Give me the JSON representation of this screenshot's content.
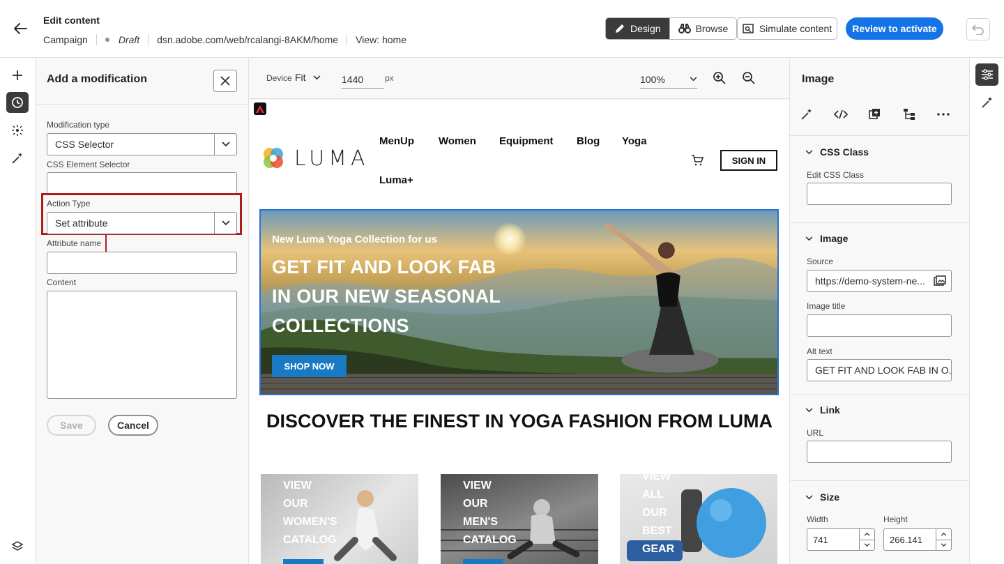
{
  "header": {
    "title": "Edit content",
    "meta": {
      "type": "Campaign",
      "status": "Draft",
      "url": "dsn.adobe.com/web/rcalangi-8AKM/home",
      "view": "View: home"
    },
    "design_label": "Design",
    "browse_label": "Browse",
    "simulate_label": "Simulate content",
    "review_label": "Review to activate"
  },
  "left_panel": {
    "title": "Add a modification",
    "modification_type_label": "Modification type",
    "modification_type_value": "CSS Selector",
    "css_selector_label": "CSS Element Selector",
    "css_selector_value": "",
    "action_type_label": "Action Type",
    "action_type_value": "Set attribute",
    "attribute_name_label": "Attribute name",
    "attribute_name_value": "",
    "content_label": "Content",
    "content_value": "",
    "save_label": "Save",
    "cancel_label": "Cancel"
  },
  "canvas_toolbar": {
    "device_label": "Device",
    "device_value": "Fit",
    "width_value": "1440",
    "width_unit": "px",
    "zoom_value": "100%"
  },
  "site": {
    "logo_text": "LUMA",
    "nav": [
      "MenUp",
      "Women",
      "Equipment",
      "Blog",
      "Yoga",
      "Luma+"
    ],
    "signin_label": "SIGN IN",
    "hero": {
      "subtitle": "New Luma Yoga Collection for us",
      "lines": [
        "GET FIT AND LOOK FAB",
        "IN OUR NEW SEASONAL",
        "COLLECTIONS"
      ],
      "cta": "SHOP NOW"
    },
    "discover_heading": "DISCOVER THE FINEST IN YOGA FASHION FROM LUMA",
    "tiles": [
      {
        "lines": [
          "VIEW",
          "OUR",
          "WOMEN'S",
          "CATALOG"
        ]
      },
      {
        "lines": [
          "VIEW",
          "OUR",
          "MEN'S",
          "CATALOG"
        ]
      },
      {
        "lines": [
          "VIEW",
          "ALL",
          "OUR",
          "BEST",
          "GEAR"
        ]
      }
    ]
  },
  "right_panel": {
    "title": "Image",
    "css_class_section": "CSS Class",
    "edit_css_class_label": "Edit CSS Class",
    "edit_css_class_value": "",
    "image_section": "Image",
    "source_label": "Source",
    "source_value": "https://demo-system-ne...",
    "image_title_label": "Image title",
    "image_title_value": "",
    "alt_text_label": "Alt text",
    "alt_text_value": "GET FIT AND LOOK FAB IN O...",
    "link_section": "Link",
    "url_label": "URL",
    "url_value": "",
    "size_section": "Size",
    "width_label": "Width",
    "width_value": "741",
    "height_label": "Height",
    "height_value": "266.141"
  },
  "icons": {
    "accent": "#1473e6",
    "highlight": "#b01c1c",
    "link_blue": "#1979c3"
  }
}
